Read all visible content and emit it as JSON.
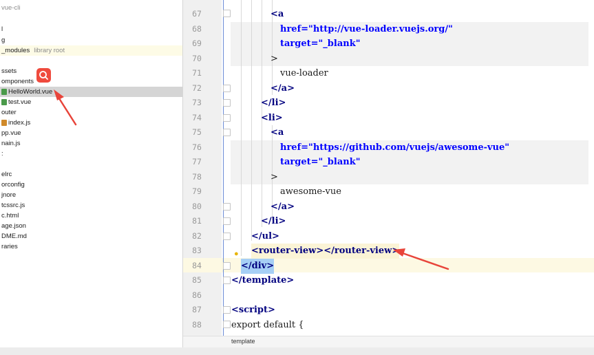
{
  "tree": {
    "items": [
      {
        "label": "vue-cli",
        "style": "muted"
      },
      {
        "label": "l"
      },
      {
        "label": "g"
      },
      {
        "label": "_modules",
        "note": "library root",
        "style": "hl"
      },
      {
        "label": ""
      },
      {
        "label": "ssets"
      },
      {
        "label": "omponents"
      },
      {
        "label": "HelloWorld.vue",
        "icon": "vue-file-icon",
        "style": "sel"
      },
      {
        "label": "test.vue",
        "icon": "vue-file-icon"
      },
      {
        "label": "outer"
      },
      {
        "label": "index.js",
        "icon": "js-file-icon"
      },
      {
        "label": "pp.vue"
      },
      {
        "label": "nain.js"
      },
      {
        "label": ":"
      },
      {
        "label": ""
      },
      {
        "label": "elrc"
      },
      {
        "label": "orconfig"
      },
      {
        "label": "jnore"
      },
      {
        "label": "tcssrc.js"
      },
      {
        "label": "c.html"
      },
      {
        "label": "age.json"
      },
      {
        "label": "DME.md"
      },
      {
        "label": "raries"
      }
    ],
    "search_icon": "search-icon"
  },
  "editor": {
    "lines": [
      {
        "num": "67",
        "text": "<a"
      },
      {
        "num": "68",
        "text": "href=\"http://vue-loader.vuejs.org/\""
      },
      {
        "num": "69",
        "text": "target=\"_blank\""
      },
      {
        "num": "70",
        "text": ">"
      },
      {
        "num": "71",
        "text": "vue-loader"
      },
      {
        "num": "72",
        "text": "</a>"
      },
      {
        "num": "73",
        "text": "</li>"
      },
      {
        "num": "74",
        "text": "<li>"
      },
      {
        "num": "75",
        "text": "<a"
      },
      {
        "num": "76",
        "text": "href=\"https://github.com/vuejs/awesome-vue\""
      },
      {
        "num": "77",
        "text": "target=\"_blank\""
      },
      {
        "num": "78",
        "text": ">"
      },
      {
        "num": "79",
        "text": "awesome-vue"
      },
      {
        "num": "80",
        "text": "</a>"
      },
      {
        "num": "81",
        "text": "</li>"
      },
      {
        "num": "82",
        "text": "</ul>"
      },
      {
        "num": "83",
        "text": "<router-view></router-view>"
      },
      {
        "num": "84",
        "text": "</div>"
      },
      {
        "num": "85",
        "text": "</template>"
      },
      {
        "num": "86",
        "text": ""
      },
      {
        "num": "87",
        "text": "<script>"
      },
      {
        "num": "88",
        "text": "export default {"
      }
    ],
    "breadcrumb": "template"
  },
  "colors": {
    "tag": "#00007f",
    "attr": "#0000ff",
    "string": "#067d17",
    "annotation_arrow": "#e8443a",
    "search_button": "#ef4a3d"
  }
}
